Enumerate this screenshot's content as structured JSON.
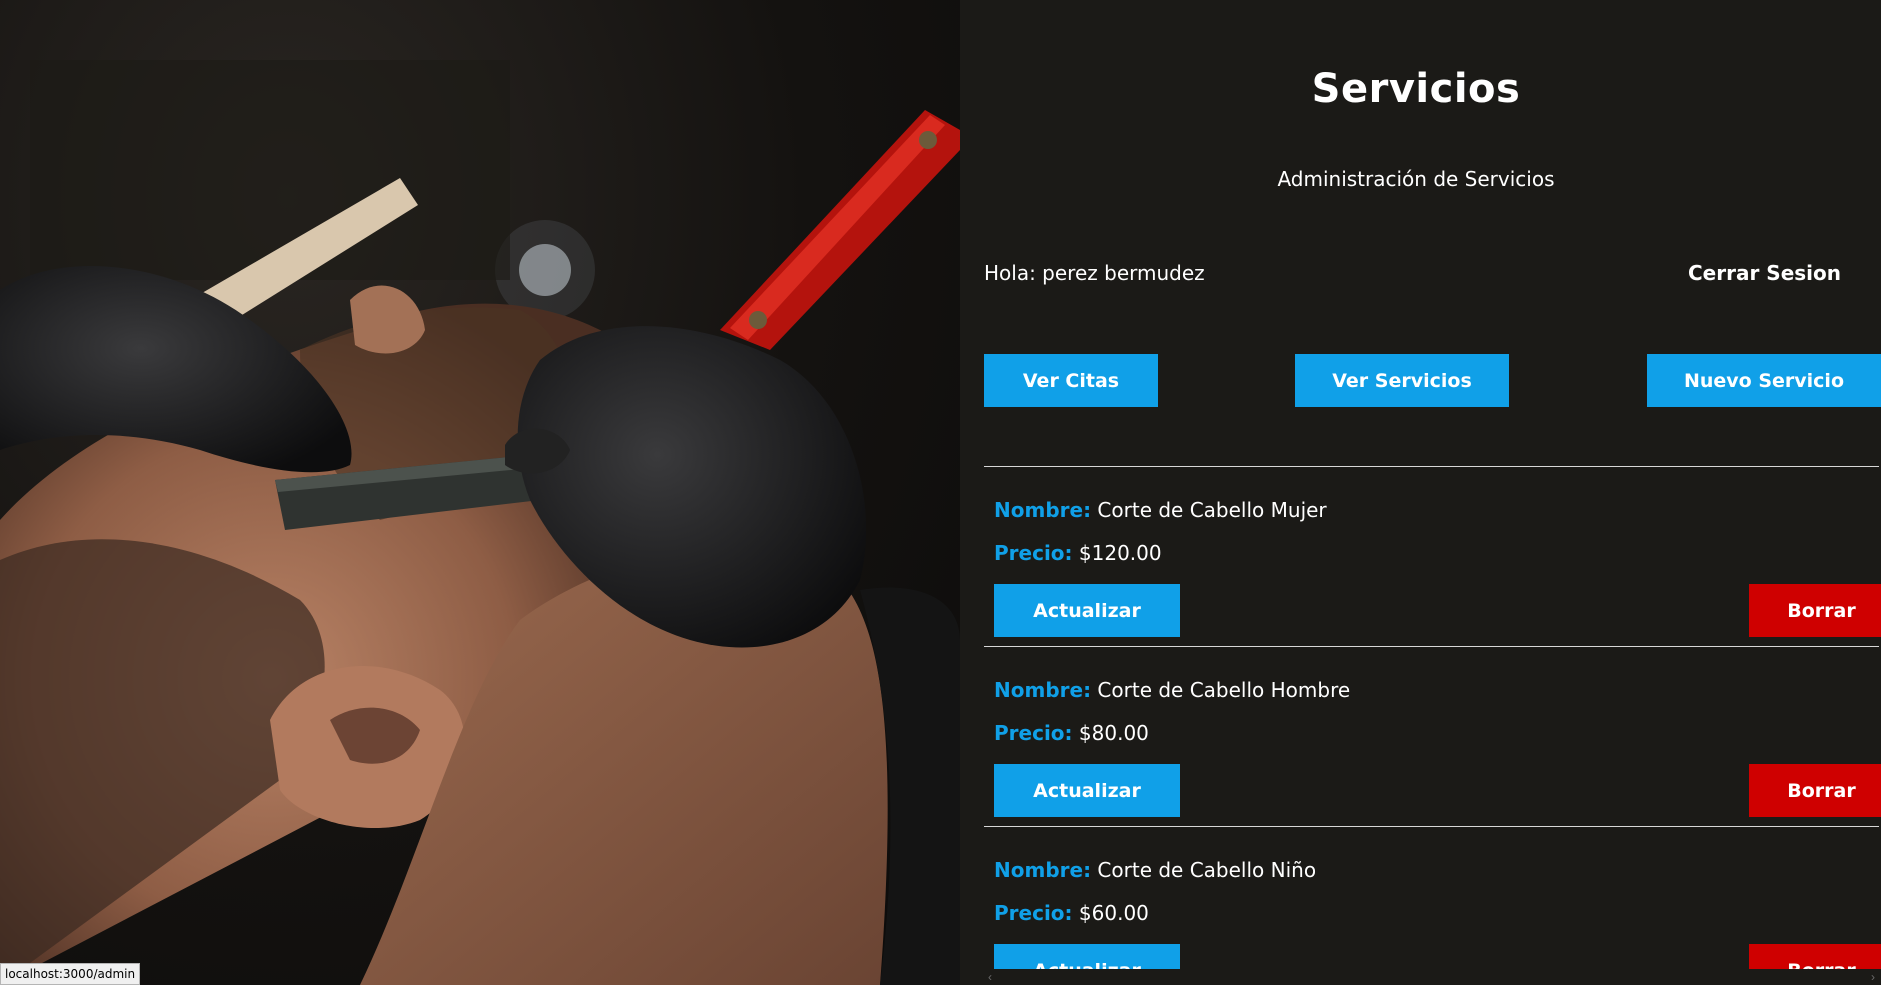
{
  "header": {
    "title": "Servicios",
    "subtitle": "Administración de Servicios"
  },
  "user": {
    "greeting": "Hola: perez bermudez",
    "logout_label": "Cerrar Sesion"
  },
  "nav": {
    "citas_label": "Ver Citas",
    "servicios_label": "Ver Servicios",
    "nuevo_label": "Nuevo Servicio"
  },
  "labels": {
    "name_key": "Nombre:",
    "price_key": "Precio:",
    "update_label": "Actualizar",
    "delete_label": "Borrar"
  },
  "services": [
    {
      "name": "Corte de Cabello Mujer",
      "price": "$120.00"
    },
    {
      "name": "Corte de Cabello Hombre",
      "price": "$80.00"
    },
    {
      "name": "Corte de Cabello Niño",
      "price": "$60.00"
    }
  ],
  "status_bar": {
    "url": "localhost:3000/admin"
  },
  "colors": {
    "accent": "#10a0e8",
    "danger": "#cf0000",
    "background": "#1b1a17"
  },
  "icons": {
    "scroll_left": "chevron-left-icon",
    "scroll_right": "chevron-right-icon"
  }
}
